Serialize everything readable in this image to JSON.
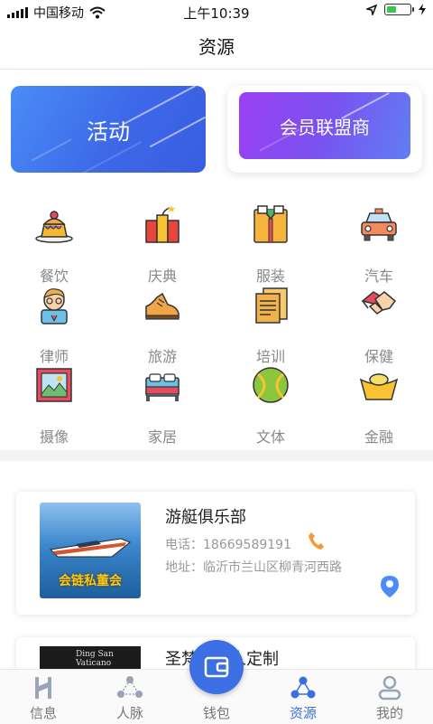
{
  "status_bar": {
    "carrier": "中国移动",
    "time": "上午10:39",
    "icons": [
      "signal-icon",
      "wifi-icon",
      "location-arrow-icon",
      "battery-icon",
      "charging-icon"
    ]
  },
  "nav": {
    "title": "资源"
  },
  "banners": [
    {
      "label": "活动"
    },
    {
      "label": "会员联盟商"
    }
  ],
  "categories": [
    {
      "label": "餐饮",
      "icon": "cake-icon"
    },
    {
      "label": "庆典",
      "icon": "firecracker-icon"
    },
    {
      "label": "服装",
      "icon": "shirt-icon"
    },
    {
      "label": "汽车",
      "icon": "car-icon"
    },
    {
      "label": "律师",
      "icon": "lawyer-icon"
    },
    {
      "label": "旅游",
      "icon": "shoe-icon"
    },
    {
      "label": "培训",
      "icon": "documents-icon"
    },
    {
      "label": "保健",
      "icon": "handshake-icon"
    },
    {
      "label": "摄像",
      "icon": "picture-icon"
    },
    {
      "label": "家居",
      "icon": "bed-icon"
    },
    {
      "label": "文体",
      "icon": "ball-icon"
    },
    {
      "label": "金融",
      "icon": "gold-ingot-icon"
    }
  ],
  "listings": [
    {
      "title": "游艇俱乐部",
      "phone": "电话：18669589191",
      "address": "地址：临沂市兰山区柳青河西路",
      "thumb_caption": "会链私董会"
    },
    {
      "title": "圣梵　　人定制",
      "thumb_text": "Ding San Vaticano"
    }
  ],
  "tabs": [
    {
      "label": "信息",
      "icon": "info-logo-icon",
      "active": false
    },
    {
      "label": "人脉",
      "icon": "network-icon",
      "active": false
    },
    {
      "label": "钱包",
      "icon": "wallet-icon",
      "active": false
    },
    {
      "label": "资源",
      "icon": "resources-icon",
      "active": true
    },
    {
      "label": "我的",
      "icon": "profile-icon",
      "active": false
    }
  ],
  "colors": {
    "accent": "#3b6fe0",
    "label_gray": "#888888"
  }
}
